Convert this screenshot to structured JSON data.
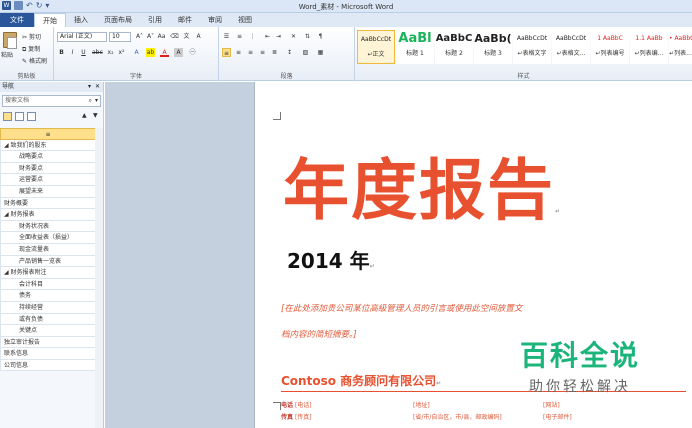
{
  "window": {
    "title": "Word_素材 - Microsoft Word"
  },
  "tabs": [
    "文件",
    "开始",
    "插入",
    "页面布局",
    "引用",
    "邮件",
    "审阅",
    "视图"
  ],
  "ribbon": {
    "clipboard": {
      "paste": "粘贴",
      "cut": "剪切",
      "copy": "复制",
      "format_painter": "格式刷",
      "label": "剪贴板"
    },
    "font": {
      "name": "Arial (正文)",
      "size": "10",
      "label": "字体"
    },
    "paragraph": {
      "label": "段落"
    },
    "styles": {
      "label": "样式",
      "items": [
        {
          "sample": "AaBbCcDt",
          "name": "↵正文"
        },
        {
          "sample": "AaBl",
          "name": "标题 1"
        },
        {
          "sample": "AaBbC",
          "name": "标题 2"
        },
        {
          "sample": "AaBb(",
          "name": "标题 3"
        },
        {
          "sample": "AaBbCcDt",
          "name": "↵表格文字"
        },
        {
          "sample": "AaBbCcDt",
          "name": "↵表格文..."
        },
        {
          "sample": "1 AaBbC",
          "name": "↵列表编号"
        },
        {
          "sample": "1.1 AaBb",
          "name": "↵列表编..."
        },
        {
          "sample": "• AaBbCc",
          "name": "↵列表..."
        }
      ]
    }
  },
  "nav": {
    "title": "导航",
    "search_placeholder": "搜索文档",
    "items": [
      {
        "label": "",
        "indent": 0,
        "current": true
      },
      {
        "label": "◢ 致我们的股东",
        "indent": 0
      },
      {
        "label": "战略要点",
        "indent": 1
      },
      {
        "label": "财务要点",
        "indent": 1
      },
      {
        "label": "运营要点",
        "indent": 1
      },
      {
        "label": "展望未来",
        "indent": 1
      },
      {
        "label": "财务概要",
        "indent": 0
      },
      {
        "label": "◢ 财务报表",
        "indent": 0
      },
      {
        "label": "财务状况表",
        "indent": 1
      },
      {
        "label": "全面收益表（损益）",
        "indent": 1
      },
      {
        "label": "现金流量表",
        "indent": 1
      },
      {
        "label": "产品销售一览表",
        "indent": 1
      },
      {
        "label": "◢ 财务报表附注",
        "indent": 0
      },
      {
        "label": "会计科目",
        "indent": 1
      },
      {
        "label": "债务",
        "indent": 1
      },
      {
        "label": "持续经营",
        "indent": 1
      },
      {
        "label": "或有负债",
        "indent": 1
      },
      {
        "label": "关键点",
        "indent": 1
      },
      {
        "label": "独立审计报告",
        "indent": 0
      },
      {
        "label": "联系信息",
        "indent": 0
      },
      {
        "label": "公司信息",
        "indent": 0
      }
    ]
  },
  "document": {
    "title": "年度报告",
    "year": "2014 年",
    "abstract_line1": "[在此处添加贵公司某位高级管理人员的引言或使用此空间放置文",
    "abstract_line2": "档内容的简短摘要。]",
    "company": "Contoso 商务顾问有限公司",
    "contact": {
      "phone_label": "电话",
      "phone_value": "[电话]",
      "fax_label": "传真",
      "fax_value": "[传真]",
      "address": "[地址]",
      "city": "[省/市/自治区，市/县，邮政编码]",
      "website": "[网站]",
      "email": "[电子邮件]"
    }
  },
  "watermark": {
    "main": "百科全说",
    "sub": "助你轻松解决"
  }
}
